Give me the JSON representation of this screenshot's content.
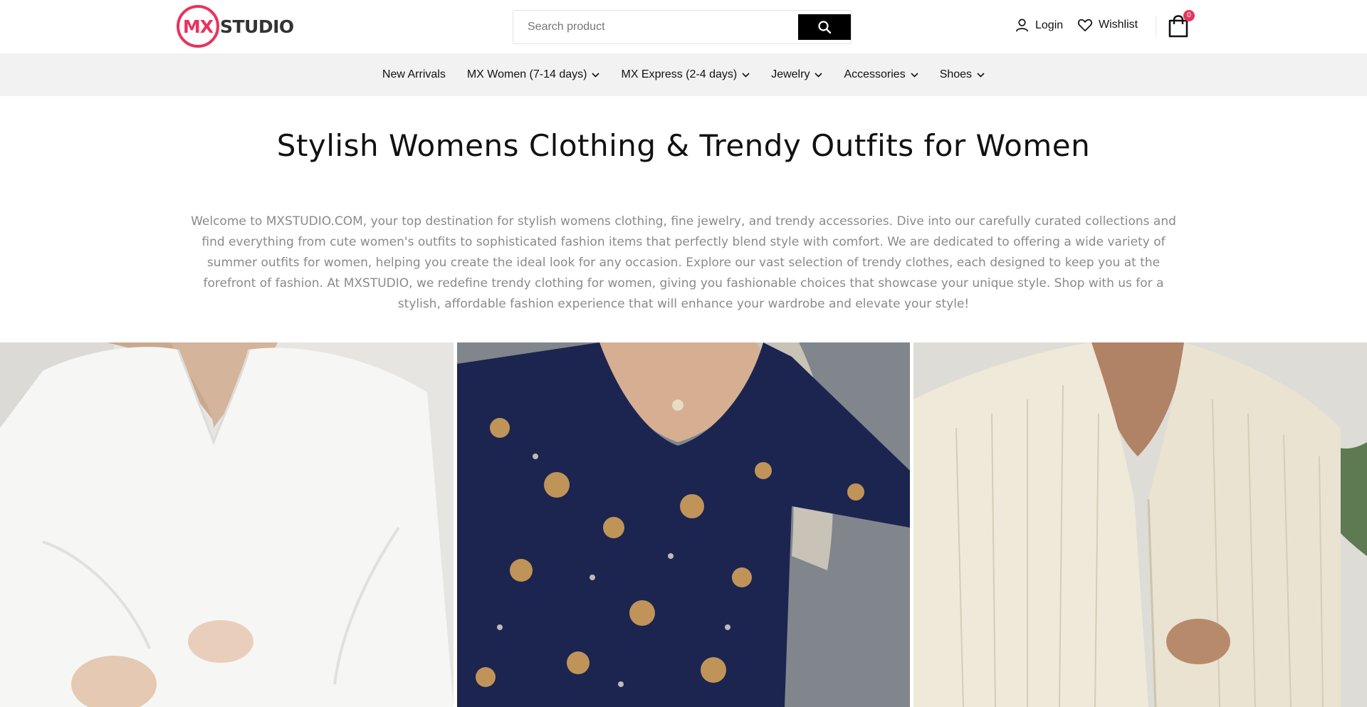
{
  "brand": {
    "logo_mark": "MX",
    "logo_word": "STUDIO",
    "accent_color": "#e8335d"
  },
  "search": {
    "placeholder": "Search product",
    "icon": "search-icon"
  },
  "header": {
    "login_label": "Login",
    "wishlist_label": "Wishlist",
    "cart_count": "0"
  },
  "nav": {
    "items": [
      {
        "label": "New Arrivals",
        "has_dropdown": false
      },
      {
        "label": "MX Women (7-14 days)",
        "has_dropdown": true
      },
      {
        "label": "MX Express (2-4 days)",
        "has_dropdown": true
      },
      {
        "label": "Jewelry",
        "has_dropdown": true
      },
      {
        "label": "Accessories",
        "has_dropdown": true
      },
      {
        "label": "Shoes",
        "has_dropdown": true
      }
    ]
  },
  "main": {
    "title": "Stylish Womens Clothing & Trendy Outfits for Women",
    "intro": "Welcome to MXSTUDIO.COM, your top destination for stylish womens clothing, fine jewelry, and trendy accessories. Dive into our carefully curated collections and find everything from cute women's outfits to sophisticated fashion items that perfectly blend style with comfort. We are dedicated to offering a wide variety of summer outfits for women, helping you create the ideal look for any occasion. Explore our vast selection of trendy clothes, each designed to keep you at the forefront of fashion. At MXSTUDIO, we redefine trendy clothing for women, giving you fashionable choices that showcase your unique style. Shop with us for a stylish, affordable fashion experience that will enhance your wardrobe and elevate your style!"
  },
  "gallery": {
    "products": [
      {
        "image": "white-blouse-photo"
      },
      {
        "image": "navy-floral-dress-photo"
      },
      {
        "image": "cream-pleated-shirt-photo"
      }
    ]
  }
}
